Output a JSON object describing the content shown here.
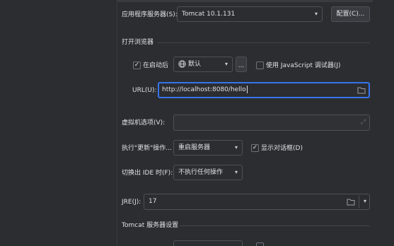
{
  "app_server": {
    "label": "应用程序服务器(S):",
    "value": "Tomcat 10.1.131",
    "configure_button": "配置(C)..."
  },
  "browser": {
    "section_title": "打开浏览器",
    "after_launch_label": "在启动后",
    "after_launch_checked": true,
    "browser_value": "默认",
    "more_button": "...",
    "use_js_debugger_label": "使用 JavaScript 调试器(J)",
    "use_js_debugger_checked": false,
    "url_label": "URL(U):",
    "url_value": "http://localhost:8080/hello"
  },
  "vm_options": {
    "label": "虚拟机选项(V):",
    "value": ""
  },
  "on_update": {
    "label": "执行\"更新\"操作...",
    "value": "重启服务器",
    "show_dialog_label": "显示对话框(D)",
    "show_dialog_checked": true
  },
  "frame_deactivation": {
    "label": "切换出 IDE 时(F):",
    "value": "不执行任何操作"
  },
  "jre": {
    "label": "JRE(J):",
    "value": "17"
  },
  "tomcat_settings": {
    "section_title": "Tomcat 服务器设置"
  },
  "icons": {
    "check": "✓",
    "dropdown": "▾",
    "expand": "⤢"
  },
  "colors": {
    "background": "#2b2d30",
    "accent": "#3574f0",
    "text": "#dfe1e5"
  }
}
